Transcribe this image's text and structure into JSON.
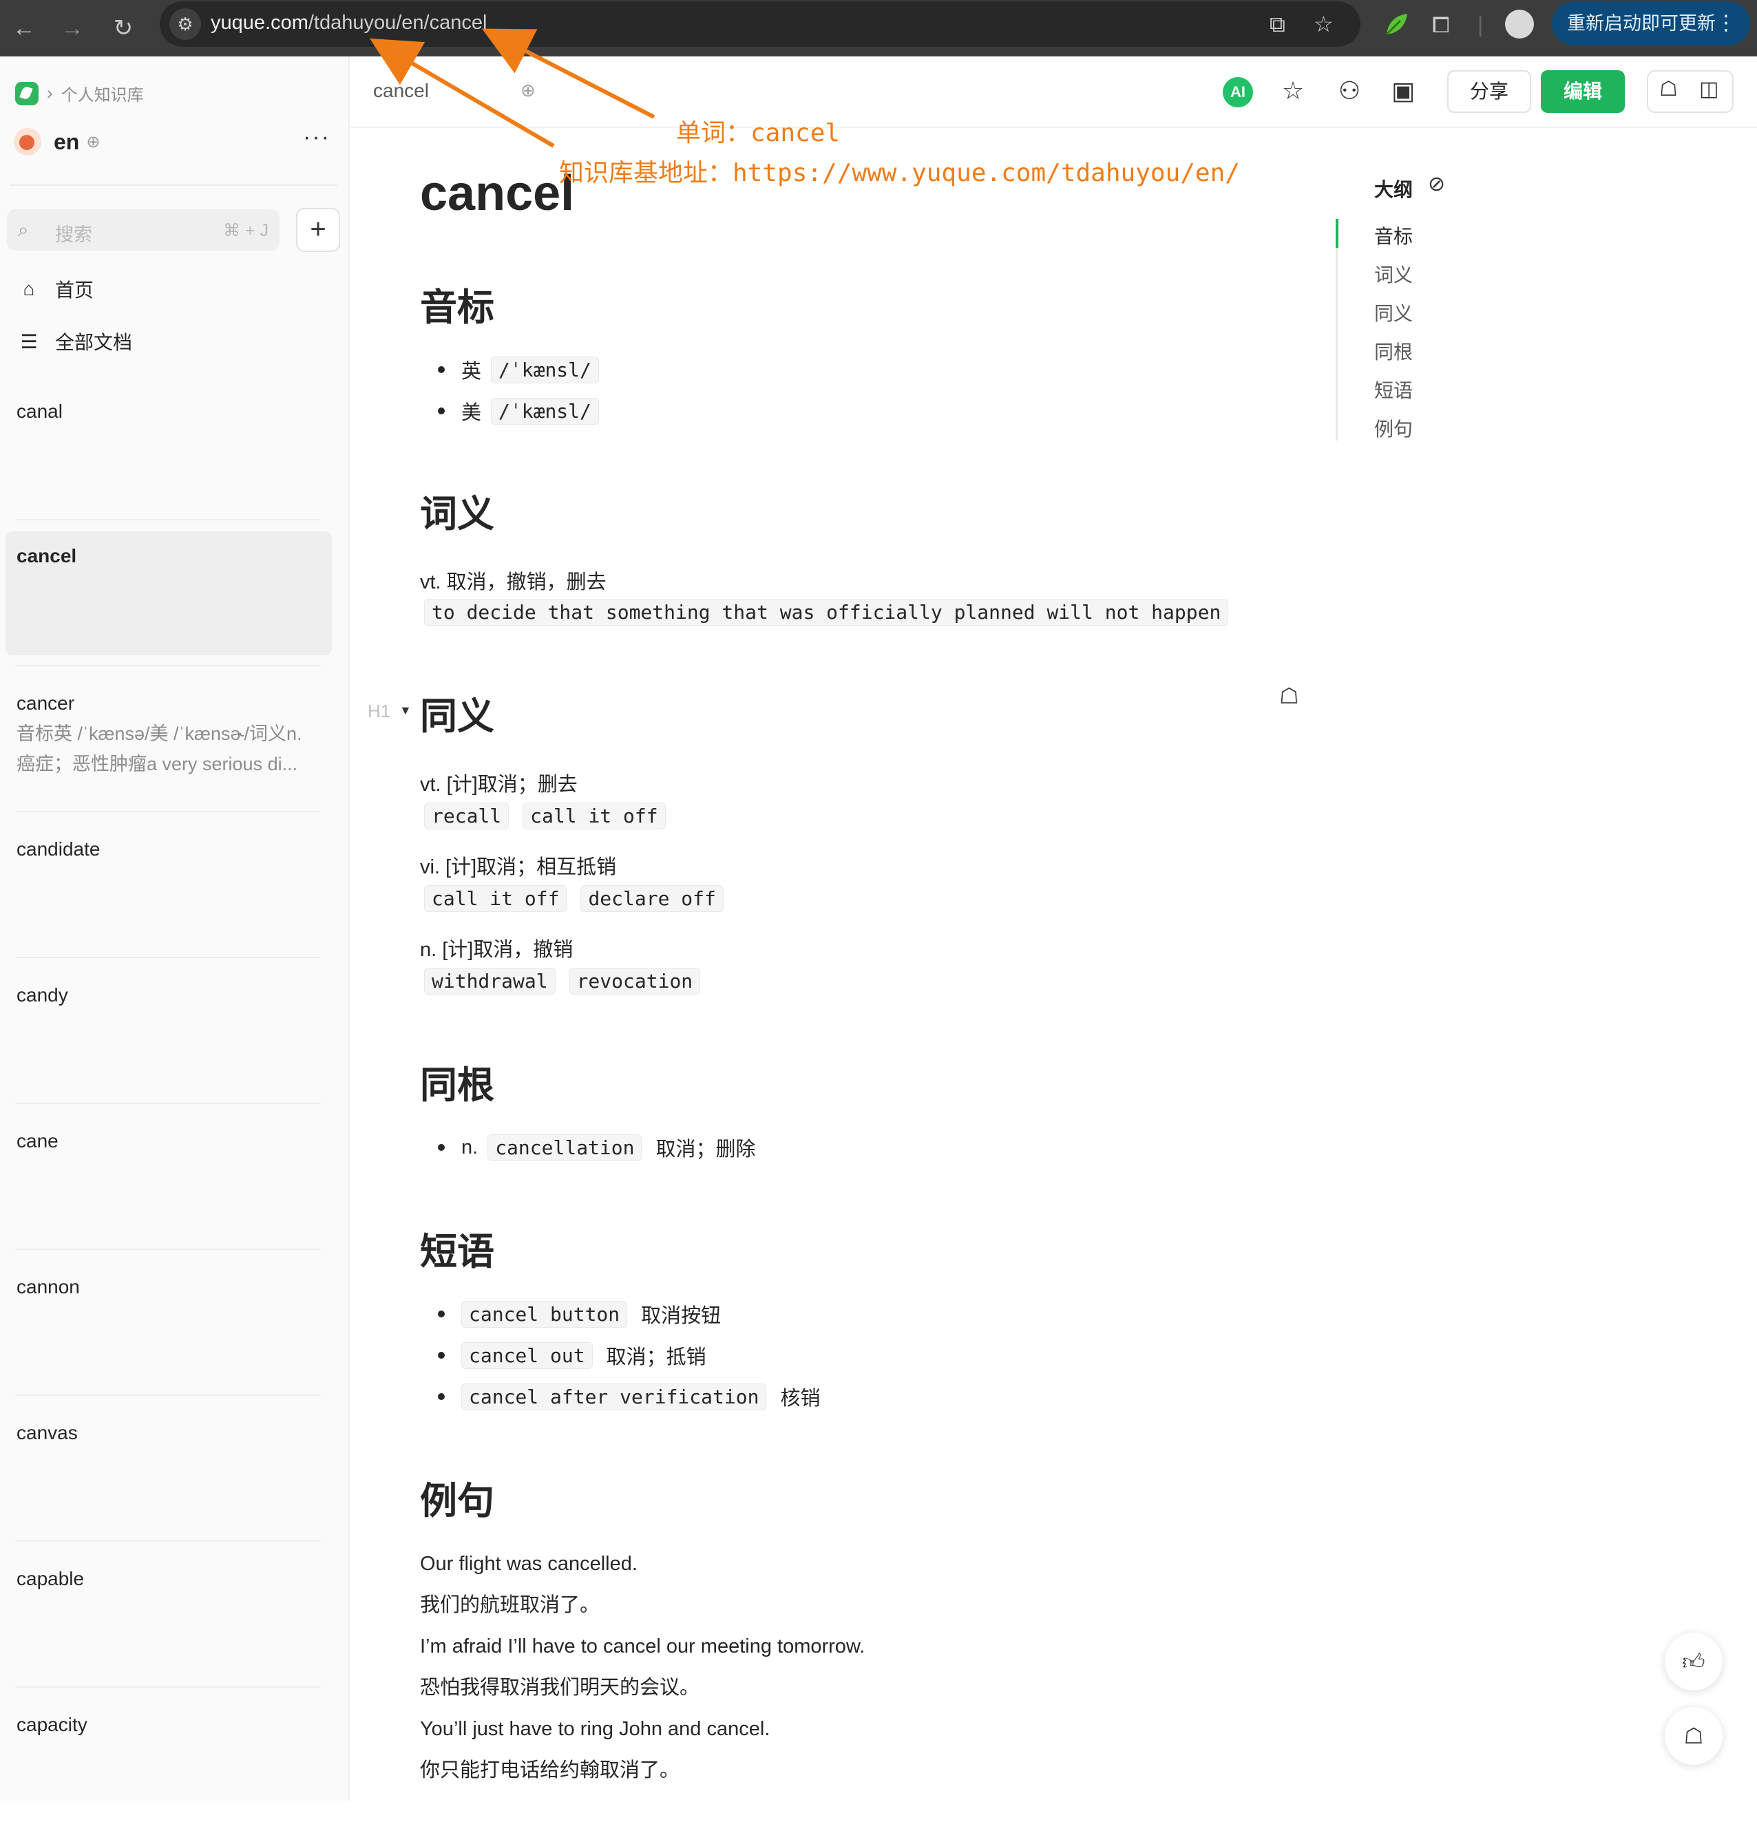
{
  "browser": {
    "url_host": "yuque.com",
    "url_path": "/tdahuyou/en/cancel",
    "update_label": "重新启动即可更新"
  },
  "sidebar": {
    "breadcrumb": "个人知识库",
    "book_title": "en",
    "search_placeholder": "搜索",
    "search_shortcut": "⌘ + J",
    "nav": [
      {
        "label": "首页",
        "icon": "home-icon"
      },
      {
        "label": "全部文档",
        "icon": "list-icon"
      }
    ],
    "docs": [
      {
        "title": "canal",
        "summary": ""
      },
      {
        "title": "cancel",
        "summary": "",
        "active": true
      },
      {
        "title": "cancer",
        "summary": "音标英 /ˈkænsə/美 /ˈkænsɚ/词义n. 癌症；恶性肿瘤a very serious di..."
      },
      {
        "title": "candidate",
        "summary": ""
      },
      {
        "title": "candy",
        "summary": ""
      },
      {
        "title": "cane",
        "summary": ""
      },
      {
        "title": "cannon",
        "summary": ""
      },
      {
        "title": "canvas",
        "summary": ""
      },
      {
        "title": "capable",
        "summary": ""
      },
      {
        "title": "capacity",
        "summary": ""
      }
    ]
  },
  "toolbar": {
    "doc_tab": "cancel",
    "ai_label": "AI",
    "share_label": "分享",
    "edit_label": "编辑"
  },
  "document": {
    "title": "cancel",
    "sections": {
      "phonetic": {
        "heading": "音标",
        "items": [
          {
            "label": "英",
            "ipa": "/ˈkænsl/"
          },
          {
            "label": "美",
            "ipa": "/ˈkænsl/"
          }
        ]
      },
      "meaning": {
        "heading": "词义",
        "text": "vt. 取消，撤销，删去",
        "definition": "to decide that something that was officially planned will not happen"
      },
      "synonyms": {
        "heading": "同义",
        "heading_marker": "H1",
        "groups": [
          {
            "text": "vt. [计]取消；删去",
            "words": [
              "recall",
              "call it off"
            ]
          },
          {
            "text": "vi. [计]取消；相互抵销",
            "words": [
              "call it off",
              "declare off"
            ]
          },
          {
            "text": "n. [计]取消，撤销",
            "words": [
              "withdrawal",
              "revocation"
            ]
          }
        ]
      },
      "cognates": {
        "heading": "同根",
        "items": [
          {
            "pos": "n.",
            "word": "cancellation",
            "meaning": "取消；删除"
          }
        ]
      },
      "phrases": {
        "heading": "短语",
        "items": [
          {
            "phrase": "cancel button",
            "meaning": "取消按钮"
          },
          {
            "phrase": "cancel out",
            "meaning": "取消；抵销"
          },
          {
            "phrase": "cancel after verification",
            "meaning": "核销"
          }
        ]
      },
      "examples": {
        "heading": "例句",
        "items": [
          {
            "en": "Our flight was cancelled.",
            "zh": "我们的航班取消了。"
          },
          {
            "en": "I’m afraid I’ll have to cancel our meeting tomorrow.",
            "zh": "恐怕我得取消我们明天的会议。"
          },
          {
            "en": "You’ll just have to ring John and cancel.",
            "zh": "你只能打电话给约翰取消了。"
          }
        ]
      }
    }
  },
  "outline": {
    "title": "大纲",
    "items": [
      "音标",
      "词义",
      "同义",
      "同根",
      "短语",
      "例句"
    ]
  },
  "annotations": {
    "word_label": "单词：cancel",
    "base_label": "知识库基地址：https://www.yuque.com/tdahuyou/en/",
    "color": "#f07c16"
  },
  "colors": {
    "accent": "#1fb45b",
    "chrome_bg": "#3c3c3c",
    "update_btn": "#0b4a7a"
  }
}
